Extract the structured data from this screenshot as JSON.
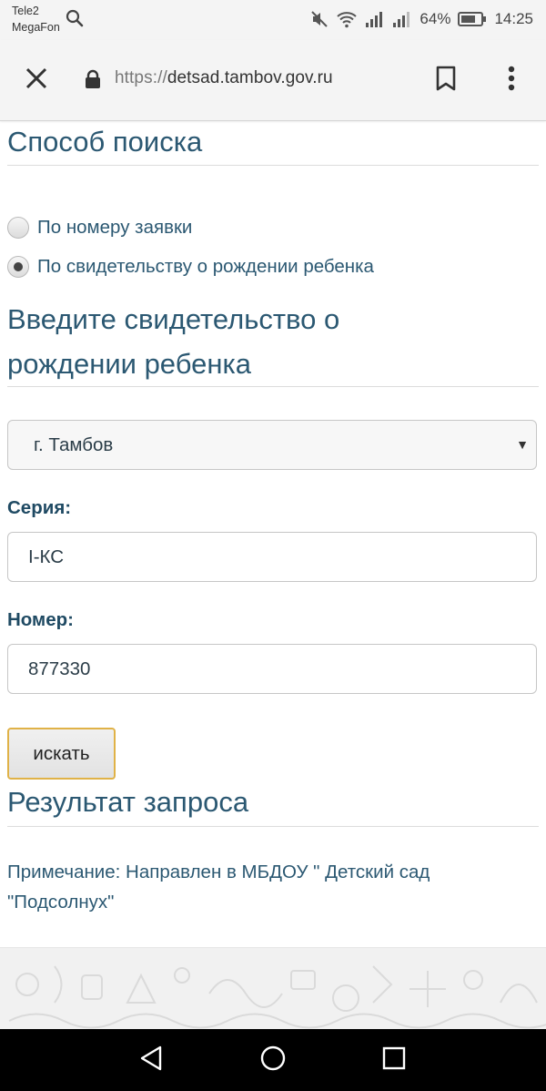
{
  "status_bar": {
    "carrier_1": "Tele2",
    "carrier_2": "MegaFon",
    "battery": "64%",
    "time": "14:25"
  },
  "browser": {
    "url_scheme": "https://",
    "url_host": "detsad.tambov.gov.ru"
  },
  "search_method": {
    "heading": "Способ поиска",
    "options": [
      {
        "label": "По номеру заявки",
        "selected": false
      },
      {
        "label": "По свидетельству о рождении ребенка",
        "selected": true
      }
    ]
  },
  "certificate": {
    "heading_line1": "Введите свидетельство о",
    "heading_line2": "рождении ребенка",
    "city_select": "г. Тамбов",
    "series_label": "Серия:",
    "series_value": "I-КС",
    "number_label": "Номер:",
    "number_value": "877330",
    "search_button": "искать"
  },
  "result": {
    "heading": "Результат запроса",
    "note_line1": "Примечание: Направлен в МБДОУ \" Детский сад",
    "note_line2": "\"Подсолнух\""
  },
  "icons": {
    "status": [
      "search-icon",
      "mute-icon",
      "wifi-icon",
      "signal-icon",
      "signal-icon",
      "battery-icon"
    ],
    "browser": [
      "close-icon",
      "lock-icon",
      "bookmark-icon",
      "more-vert-icon"
    ],
    "nav": [
      "back-icon",
      "home-icon",
      "recents-icon"
    ]
  }
}
